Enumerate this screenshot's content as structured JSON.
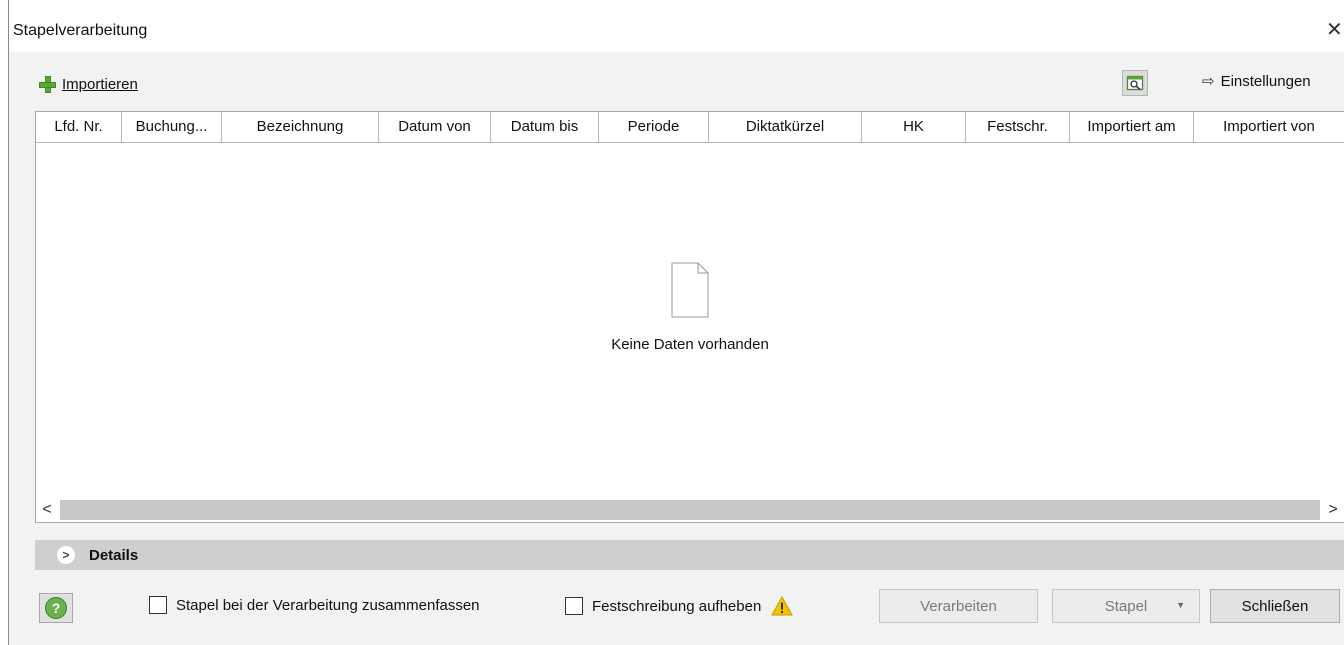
{
  "window": {
    "title": "Stapelverarbeitung",
    "close_glyph": "✕"
  },
  "toolbar": {
    "import_label": "Importieren",
    "settings_label": "Einstellungen",
    "settings_arrow": "⇨"
  },
  "grid": {
    "columns": [
      "Lfd. Nr.",
      "Buchung...",
      "Bezeichnung",
      "Datum von",
      "Datum bis",
      "Periode",
      "Diktatkürzel",
      "HK",
      "Festschr.",
      "Importiert am",
      "Importiert von"
    ],
    "empty_text": "Keine Daten vorhanden",
    "scroll_left": "<",
    "scroll_right": ">"
  },
  "details": {
    "label": "Details",
    "chevron": ">"
  },
  "footer": {
    "help_glyph": "?",
    "combine_label": "Stapel bei der Verarbeitung zusammenfassen",
    "combine_checked": false,
    "unlock_label": "Festschreibung aufheben",
    "unlock_checked": false,
    "process_label": "Verarbeiten",
    "batch_label": "Stapel",
    "batch_caret": "▼",
    "close_label": "Schließen"
  },
  "colors": {
    "accent_green": "#5aa832",
    "warning_yellow": "#f5c400",
    "details_bar": "#cfcfcf"
  }
}
